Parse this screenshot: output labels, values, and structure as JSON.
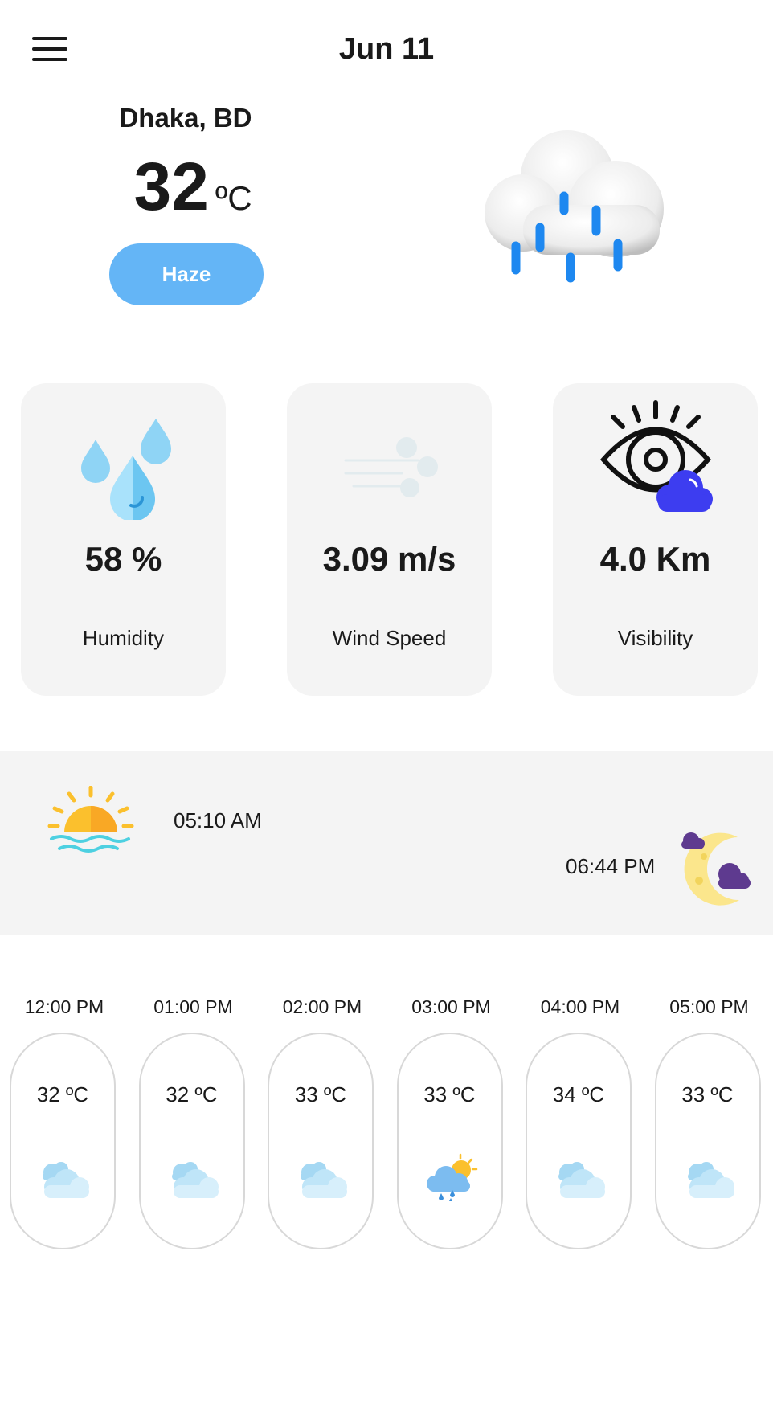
{
  "header": {
    "date": "Jun 11",
    "menu_icon": "hamburger-menu-icon"
  },
  "current": {
    "city": "Dhaka, BD",
    "temp": "32",
    "unit": "ºC",
    "condition": "Haze",
    "icon": "rain-cloud-icon"
  },
  "stats": [
    {
      "icon": "humidity-drops-icon",
      "value": "58 %",
      "label": "Humidity"
    },
    {
      "icon": "wind-icon",
      "value": "3.09 m/s",
      "label": "Wind Speed"
    },
    {
      "icon": "visibility-eye-icon",
      "value": "4.0 Km",
      "label": "Visibility"
    }
  ],
  "sun": {
    "sunrise": "05:10 AM",
    "sunset": "06:44 PM",
    "sunrise_icon": "sunrise-icon",
    "sunset_icon": "moon-icon"
  },
  "hourly": [
    {
      "time": "12:00 PM",
      "temp": "32 ºC",
      "icon": "cloudy-icon"
    },
    {
      "time": "01:00 PM",
      "temp": "32 ºC",
      "icon": "cloudy-icon"
    },
    {
      "time": "02:00 PM",
      "temp": "33 ºC",
      "icon": "cloudy-icon"
    },
    {
      "time": "03:00 PM",
      "temp": "33 ºC",
      "icon": "sun-rain-cloud-icon"
    },
    {
      "time": "04:00 PM",
      "temp": "34 ºC",
      "icon": "cloudy-icon"
    },
    {
      "time": "05:00 PM",
      "temp": "33 ºC",
      "icon": "cloudy-icon"
    }
  ],
  "colors": {
    "accent": "#64b5f6",
    "card_bg": "#f4f4f4",
    "band_bg": "#f4f4f4"
  }
}
